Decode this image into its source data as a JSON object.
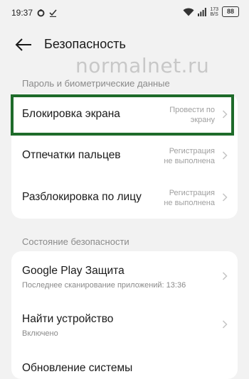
{
  "status_bar": {
    "time": "19:37",
    "net_speed_value": "173",
    "net_speed_unit": "B/S",
    "battery": "88"
  },
  "header": {
    "title": "Безопасность",
    "back_icon": "arrow-left-icon"
  },
  "watermark": "normalnet.ru",
  "sections": [
    {
      "label": "Пароль и биометрические данные",
      "items": [
        {
          "title": "Блокировка экрана",
          "value_line1": "Провести по",
          "value_line2": "экрану",
          "highlighted": true
        },
        {
          "title": "Отпечатки пальцев",
          "value_line1": "Регистрация",
          "value_line2": "не выполнена"
        },
        {
          "title": "Разблокировка по лицу",
          "value_line1": "Регистрация",
          "value_line2": "не выполнена"
        }
      ]
    },
    {
      "label": "Состояние безопасности",
      "items": [
        {
          "title": "Google Play Защита",
          "subtitle": "Последнее сканирование приложений: 13:36"
        },
        {
          "title": "Найти устройство",
          "subtitle": "Включено"
        },
        {
          "title": "Обновление системы"
        }
      ]
    }
  ],
  "colors": {
    "highlight_border": "#1e6b2a",
    "background": "#f2f2f2"
  }
}
